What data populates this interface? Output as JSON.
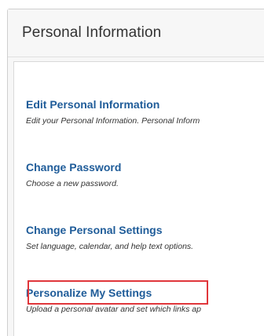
{
  "panel": {
    "title": "Personal Information"
  },
  "links": [
    {
      "title": "Edit Personal Information",
      "description": "Edit your Personal Information. Personal Inform"
    },
    {
      "title": "Change Password",
      "description": "Choose a new password."
    },
    {
      "title": "Change Personal Settings",
      "description": "Set language, calendar, and help text options."
    },
    {
      "title": "Personalize My Settings",
      "description": "Upload a personal avatar and set which links ap"
    }
  ],
  "colors": {
    "link": "#1f5c99",
    "highlight": "#e0363b",
    "panel_bg": "#f7f7f7"
  }
}
